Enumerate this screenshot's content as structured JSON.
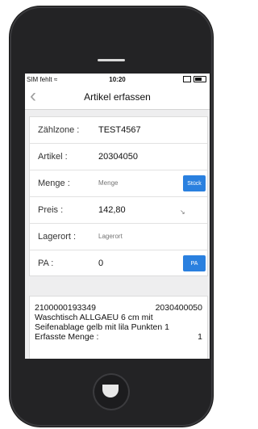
{
  "status": {
    "carrier": "SIM fehlt",
    "wifi_icon": "wifi-icon",
    "time": "10:20"
  },
  "nav": {
    "back_icon": "chevron-left-icon",
    "title": "Artikel erfassen"
  },
  "form": {
    "zaehlzone_label": "Zählzone :",
    "zaehlzone_value": "TEST4567",
    "artikel_label": "Artikel :",
    "artikel_value": "20304050",
    "menge_label": "Menge :",
    "menge_placeholder": "Menge",
    "menge_button": "Stück",
    "preis_label": "Preis :",
    "preis_value": "142,80",
    "lagerort_label": "Lagerort :",
    "lagerort_placeholder": "Lagerort",
    "pa_label": "PA :",
    "pa_value": "0",
    "pa_button": "PA"
  },
  "info": {
    "number_left": "2100000193349",
    "number_right": "2030400050",
    "line2": "Waschtisch ALLGAEU 6 cm mit",
    "line3": "Seifenablage gelb mit lila Punkten 1",
    "erfasst_label": "Erfasste Menge :",
    "erfasst_value": "1"
  },
  "colors": {
    "accent": "#2a80df",
    "phone_body": "#232325"
  }
}
